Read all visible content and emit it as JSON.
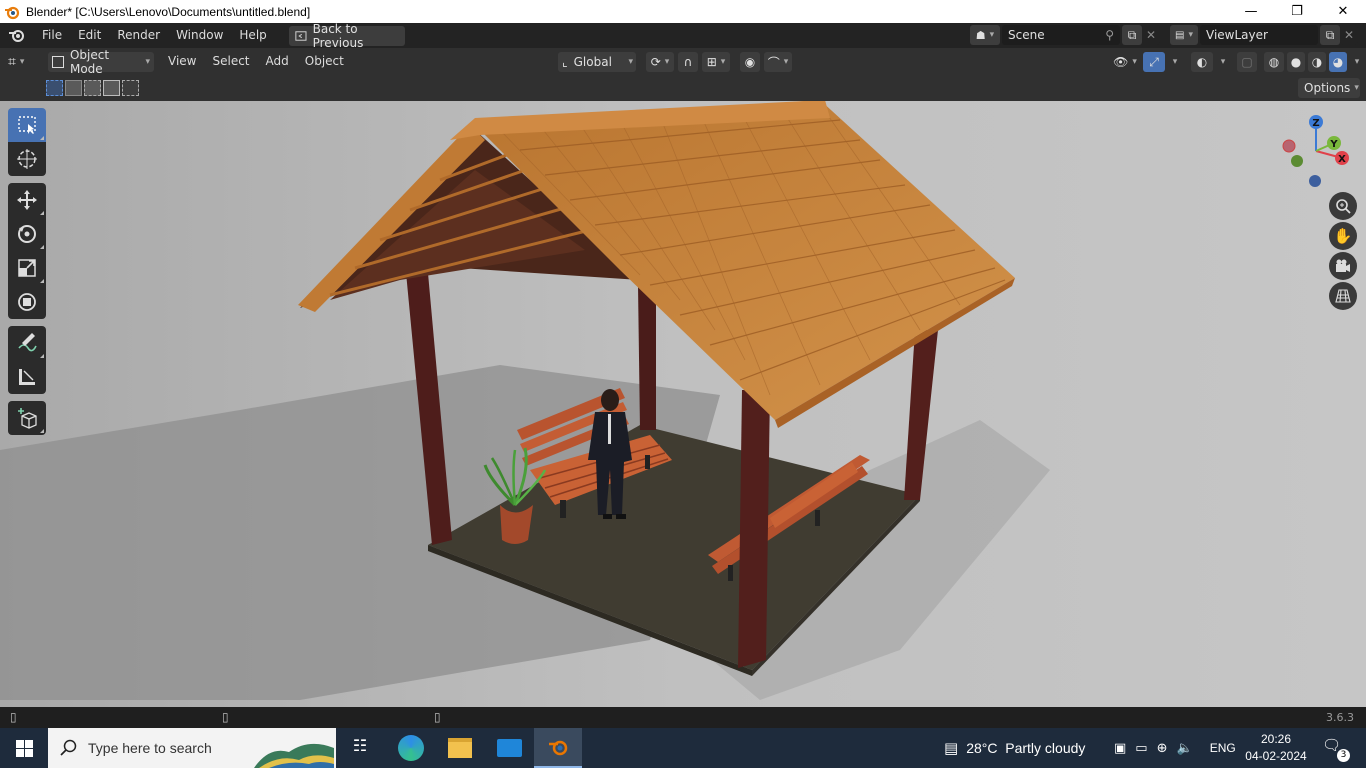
{
  "window": {
    "title": "Blender* [C:\\Users\\Lenovo\\Documents\\untitled.blend]",
    "minimize": "—",
    "restore": "❐",
    "close": "✕"
  },
  "topbar": {
    "menus": [
      "File",
      "Edit",
      "Render",
      "Window",
      "Help"
    ],
    "back_button": "Back to Previous",
    "scene": "Scene",
    "view_layer": "ViewLayer"
  },
  "header": {
    "mode": "Object Mode",
    "menus": [
      "View",
      "Select",
      "Add",
      "Object"
    ],
    "orientation": "Global"
  },
  "options_label": "Options",
  "gizmo": {
    "x": "X",
    "y": "Y",
    "z": "Z"
  },
  "status": {
    "version": "3.6.3"
  },
  "taskbar": {
    "search_placeholder": "Type here to search",
    "weather": "28°C  Partly cloudy",
    "lang": "ENG",
    "time": "20:26",
    "date": "04-02-2024",
    "notifications": "3"
  },
  "colors": {
    "accent": "#4772b3",
    "roof": "#c8833d",
    "pillar": "#4a1c1a",
    "floor": "#3f3b30"
  }
}
